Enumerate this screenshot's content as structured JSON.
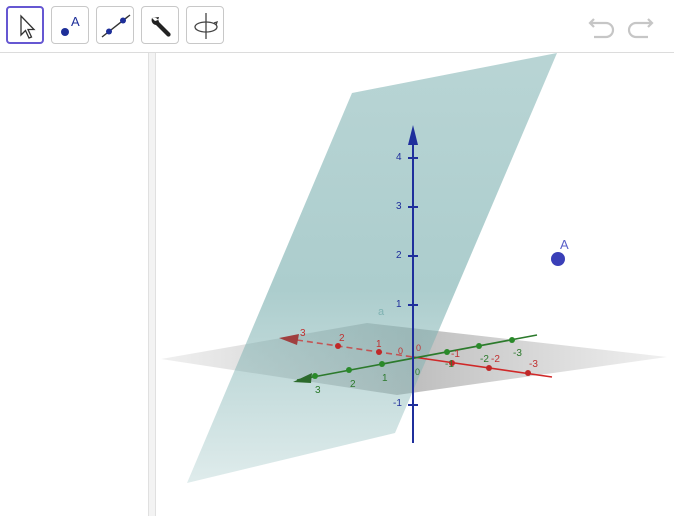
{
  "toolbar": {
    "tools": [
      {
        "name": "move-tool",
        "icon": "arrow-cursor-icon",
        "selected": true
      },
      {
        "name": "point-tool",
        "icon": "point-icon",
        "label": "A"
      },
      {
        "name": "line-tool",
        "icon": "line-through-points-icon"
      },
      {
        "name": "tools-menu",
        "icon": "wrench-icon"
      },
      {
        "name": "rotate-view-tool",
        "icon": "rotate-3d-icon"
      }
    ],
    "undo_icon": "undo-icon",
    "redo_icon": "redo-icon"
  },
  "graphics3d": {
    "point": {
      "label": "A",
      "color": "#3a3fb8"
    },
    "plane_label": "a",
    "z_ticks": [
      "4",
      "3",
      "2",
      "1",
      "-1"
    ],
    "x_ticks": [
      "3",
      "2",
      "1",
      "-1",
      "-2",
      "-3"
    ],
    "y_ticks": [
      "3",
      "2",
      "1",
      "-1",
      "-2",
      "-3"
    ],
    "origin_labels": [
      "0",
      "0",
      "0"
    ],
    "colors": {
      "z_axis": "#1f2f9c",
      "x_axis": "#d02828",
      "y_axis": "#2c7a2c",
      "plane": "#7fb2b2",
      "accent": "#6557d2"
    }
  }
}
